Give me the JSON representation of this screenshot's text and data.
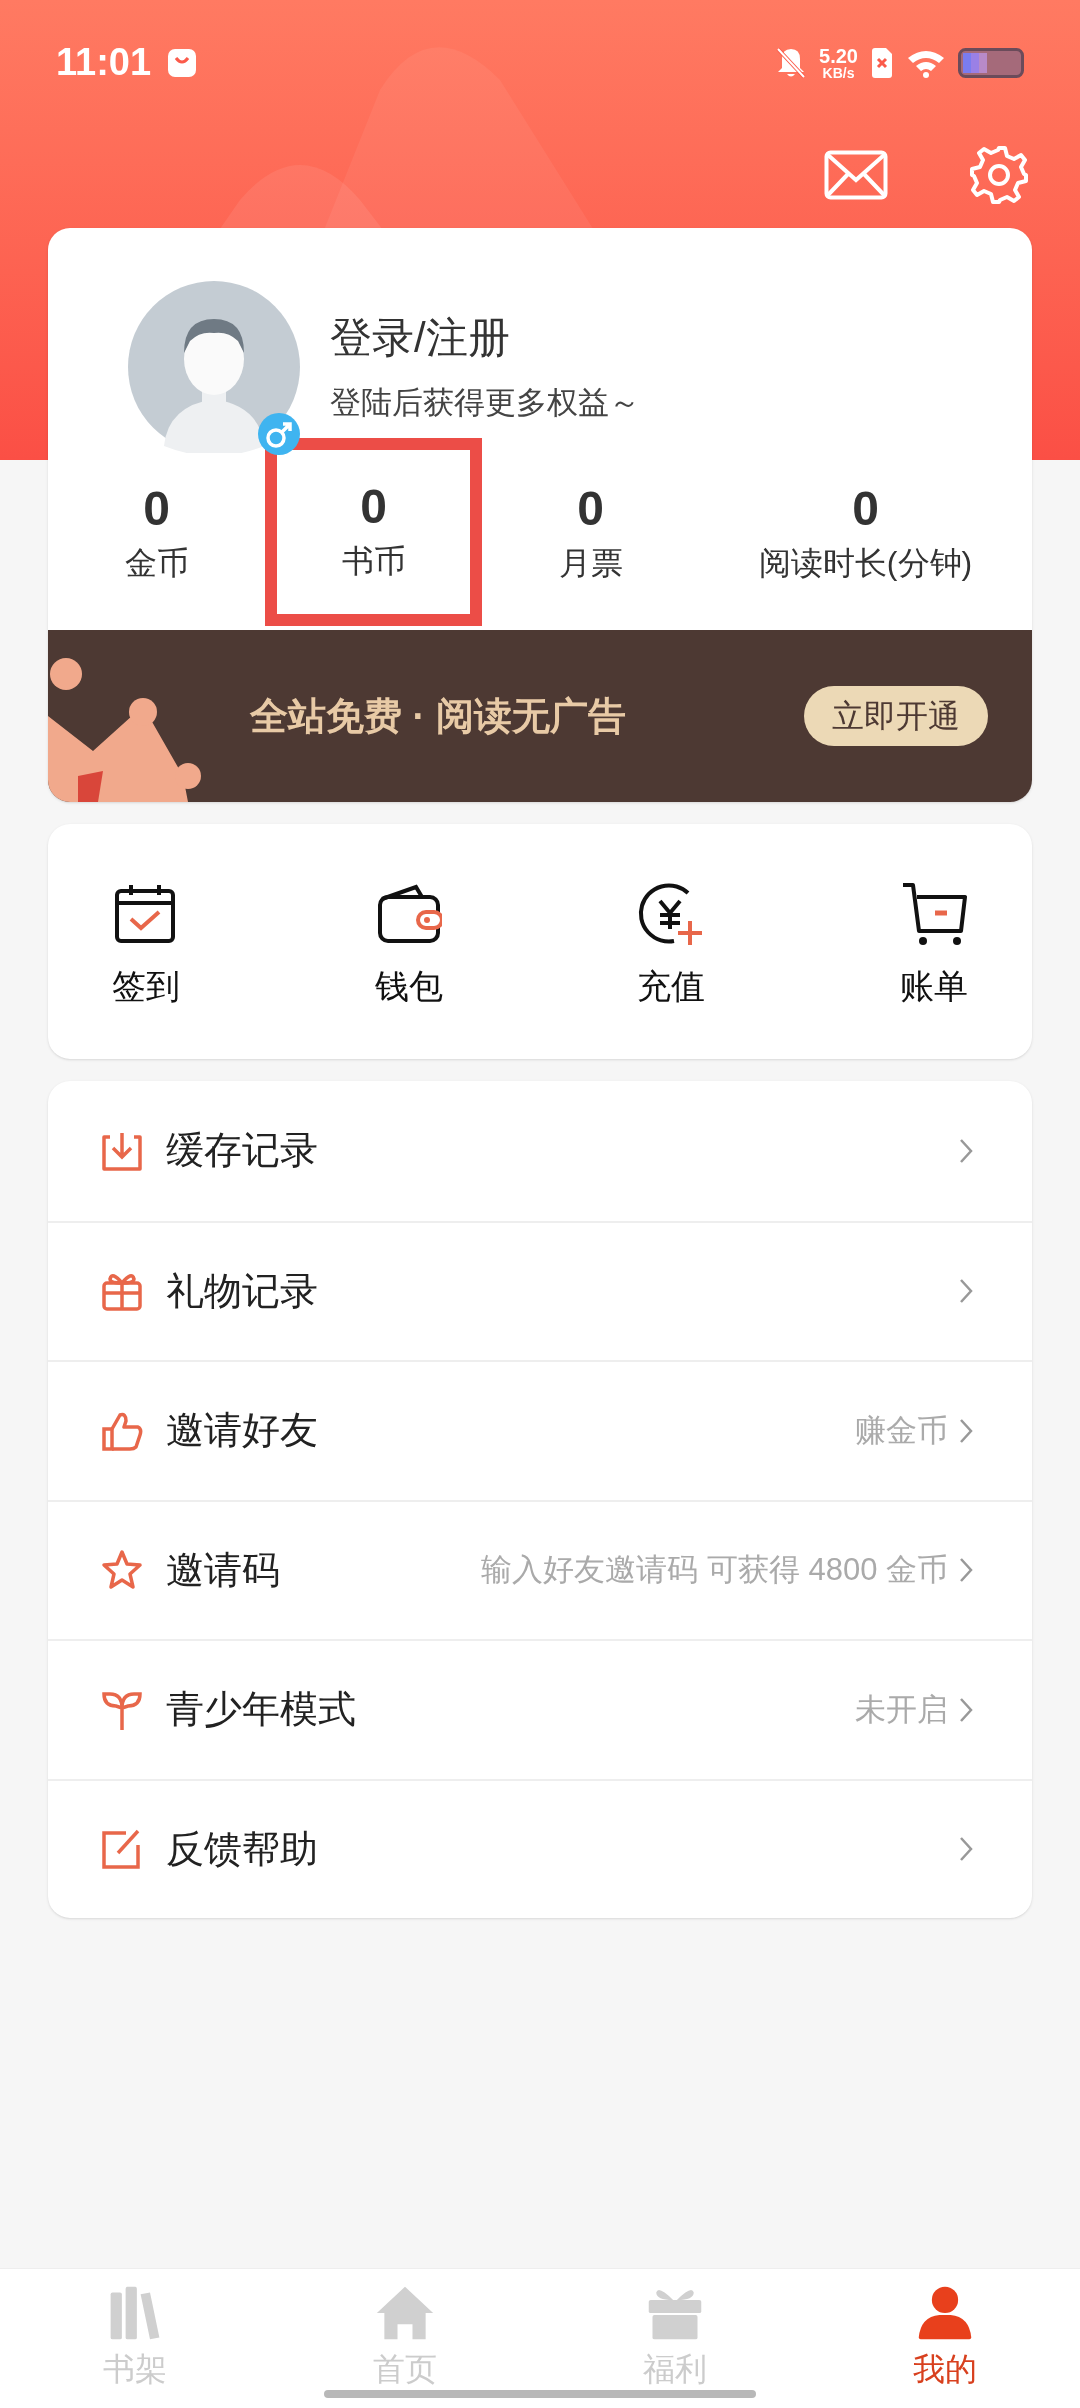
{
  "status_bar": {
    "time": "11:01",
    "speed_value": "5.20",
    "speed_unit": "KB/s"
  },
  "profile": {
    "title": "登录/注册",
    "subtitle": "登陆后获得更多权益～"
  },
  "stats": [
    {
      "value": "0",
      "label": "金币",
      "highlighted": false
    },
    {
      "value": "0",
      "label": "书币",
      "highlighted": true
    },
    {
      "value": "0",
      "label": "月票",
      "highlighted": false
    },
    {
      "value": "0",
      "label": "阅读时长(分钟)",
      "highlighted": false
    }
  ],
  "vip_banner": {
    "text": "全站免费 · 阅读无广告",
    "button": "立即开通"
  },
  "shortcuts": [
    {
      "kind": "calendar",
      "label": "签到"
    },
    {
      "kind": "wallet",
      "label": "钱包"
    },
    {
      "kind": "recharge",
      "label": "充值"
    },
    {
      "kind": "cart",
      "label": "账单"
    }
  ],
  "menu": [
    {
      "kind": "download",
      "label": "缓存记录"
    },
    {
      "kind": "gift",
      "label": "礼物记录"
    },
    {
      "kind": "thumb",
      "label": "邀请好友",
      "hint": "赚金币"
    },
    {
      "kind": "star",
      "label": "邀请码",
      "hint": "输入好友邀请码 可获得 4800 金币"
    },
    {
      "kind": "sprout",
      "label": "青少年模式",
      "hint": "未开启"
    },
    {
      "kind": "edit",
      "label": "反馈帮助"
    }
  ],
  "tab_bar": [
    {
      "kind": "shelf",
      "label": "书架",
      "selected": false
    },
    {
      "kind": "home",
      "label": "首页",
      "selected": false
    },
    {
      "kind": "gift",
      "label": "福利",
      "selected": false
    },
    {
      "kind": "person",
      "label": "我的",
      "selected": true
    }
  ]
}
